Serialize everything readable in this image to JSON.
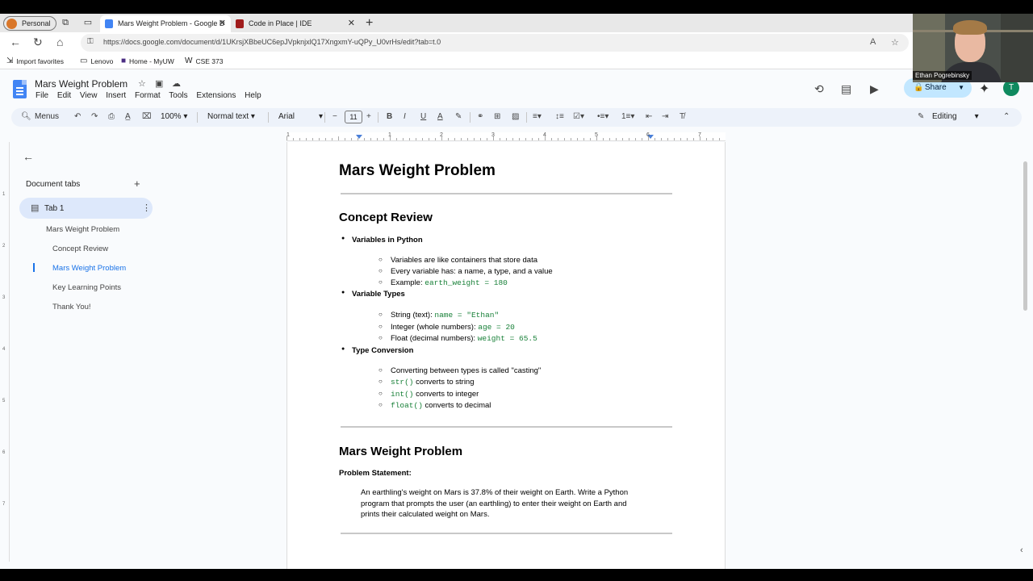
{
  "browser": {
    "profile_label": "Personal",
    "tabs": [
      {
        "title": "Mars Weight Problem - Google D",
        "active": true
      },
      {
        "title": "Code in Place | IDE",
        "active": false
      }
    ],
    "url": "https://docs.google.com/document/d/1UKrsjXBbeUC6epJVpknjxlQ17XngxmY-uQPy_U0vrHs/edit?tab=t.0",
    "bookmarks": [
      "Import favorites",
      "Lenovo",
      "Home - MyUW",
      "CSE 373"
    ]
  },
  "docs": {
    "title": "Mars Weight Problem",
    "menus": [
      "File",
      "Edit",
      "View",
      "Insert",
      "Format",
      "Tools",
      "Extensions",
      "Help"
    ],
    "share_label": "Share",
    "avatar_letter": "T",
    "toolbar": {
      "menus_label": "Menus",
      "zoom": "100%",
      "style": "Normal text",
      "font": "Arial",
      "font_size": "11",
      "mode": "Editing"
    }
  },
  "ruler": [
    "1",
    "1",
    "2",
    "3",
    "4",
    "5",
    "6",
    "7"
  ],
  "vruler": [
    "1",
    "2",
    "3",
    "4",
    "5",
    "6",
    "7"
  ],
  "sidebar": {
    "heading": "Document tabs",
    "tab_label": "Tab 1",
    "outline": [
      {
        "label": "Mars Weight Problem",
        "level": 1
      },
      {
        "label": "Concept Review",
        "level": 2
      },
      {
        "label": "Mars Weight Problem",
        "level": 2,
        "current": true
      },
      {
        "label": "Key Learning Points",
        "level": 2
      },
      {
        "label": "Thank You!",
        "level": 2
      }
    ]
  },
  "document": {
    "title": "Mars Weight Problem",
    "section1": {
      "heading": "Concept Review",
      "groups": [
        {
          "label": "Variables in Python",
          "items": [
            {
              "text": "Variables are like containers that store data",
              "code": ""
            },
            {
              "text": "Every variable has: a name, a type, and a value",
              "code": ""
            },
            {
              "text": "Example: ",
              "code": "earth_weight = 180"
            }
          ]
        },
        {
          "label": "Variable Types",
          "items": [
            {
              "text": "String (text): ",
              "code": "name = \"Ethan\""
            },
            {
              "text": "Integer (whole numbers): ",
              "code": "age = 20"
            },
            {
              "text": "Float (decimal numbers): ",
              "code": "weight = 65.5"
            }
          ]
        },
        {
          "label": "Type Conversion",
          "items": [
            {
              "text": "Converting between types is called \"casting\"",
              "code": ""
            },
            {
              "code_first": "str()",
              "text": " converts to string"
            },
            {
              "code_first": "int()",
              "text": " converts to integer"
            },
            {
              "code_first": "float()",
              "text": " converts to decimal"
            }
          ]
        }
      ]
    },
    "section2": {
      "heading": "Mars Weight Problem",
      "subheading": "Problem Statement:",
      "paragraph": "An earthling's weight on Mars is 37.8% of their weight on Earth. Write a Python program that prompts the user (an earthling) to enter their weight on Earth and prints their calculated weight on Mars."
    }
  },
  "webcam": {
    "name": "Ethan Pogrebinsky"
  },
  "colors": {
    "accent": "#1a73e8",
    "share_bg": "#c2e7ff",
    "code_green": "#188038",
    "toolbar_bg": "#edf2fa"
  }
}
